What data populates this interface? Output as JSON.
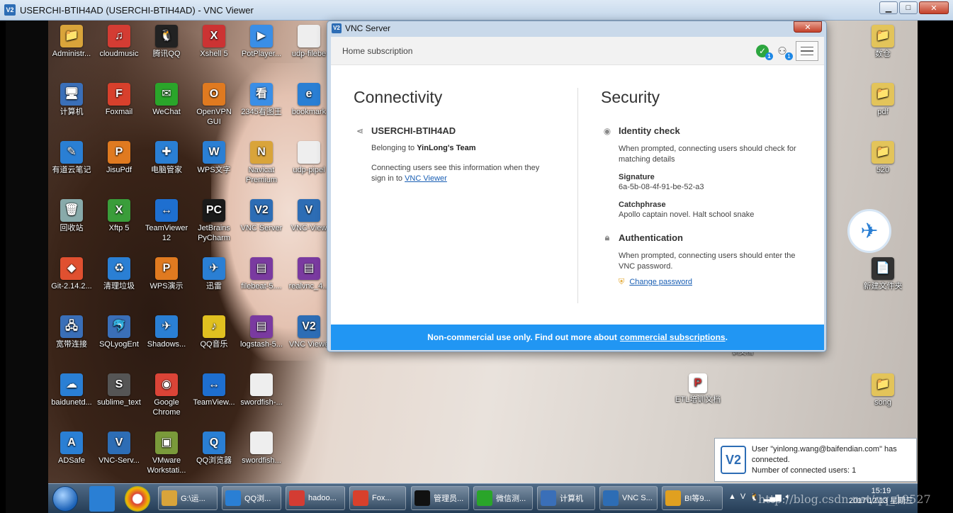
{
  "viewer": {
    "title": "USERCHI-BTIH4AD (USERCHI-BTIH4AD) - VNC Viewer",
    "minimize": "▁",
    "maximize": "□",
    "close": "✕"
  },
  "desktop_icons_left": [
    {
      "label": "Administr...",
      "color": "#d9a43a",
      "glyph": "📁"
    },
    {
      "label": "cloudmusic",
      "color": "#d43c33",
      "glyph": "♫"
    },
    {
      "label": "腾讯QQ",
      "color": "#222",
      "glyph": "🐧"
    },
    {
      "label": "Xshell 5",
      "color": "#c33",
      "glyph": "X"
    },
    {
      "label": "PotPlayer...",
      "color": "#3a8ee6",
      "glyph": "▶"
    },
    {
      "label": "udp-filebe",
      "color": "#eee",
      "glyph": ""
    },
    {
      "label": "计算机",
      "color": "#3a6fb8",
      "glyph": "🖥"
    },
    {
      "label": "Foxmail",
      "color": "#d8402c",
      "glyph": "F"
    },
    {
      "label": "WeChat",
      "color": "#2aa52a",
      "glyph": "✉"
    },
    {
      "label": "OpenVPN GUI",
      "color": "#e07a20",
      "glyph": "O"
    },
    {
      "label": "2345看图王",
      "color": "#3a8ee6",
      "glyph": "看"
    },
    {
      "label": "bookmark",
      "color": "#2a7fd4",
      "glyph": "e"
    },
    {
      "label": "有道云笔记",
      "color": "#2a7fd4",
      "glyph": "✎"
    },
    {
      "label": "JisuPdf",
      "color": "#e07a20",
      "glyph": "P"
    },
    {
      "label": "电脑管家",
      "color": "#2a7fd4",
      "glyph": "✚"
    },
    {
      "label": "WPS文字",
      "color": "#2a7fd4",
      "glyph": "W"
    },
    {
      "label": "Navicat Premium",
      "color": "#d9a43a",
      "glyph": "N"
    },
    {
      "label": "udp-pipel",
      "color": "#eee",
      "glyph": ""
    },
    {
      "label": "回收站",
      "color": "#8aa",
      "glyph": "🗑"
    },
    {
      "label": "Xftp 5",
      "color": "#3a9d3a",
      "glyph": "X"
    },
    {
      "label": "TeamViewer 12",
      "color": "#1e6fd0",
      "glyph": "↔"
    },
    {
      "label": "JetBrains PyCharm",
      "color": "#1a1a1a",
      "glyph": "PC"
    },
    {
      "label": "VNC Server",
      "color": "#2d6db5",
      "glyph": "V2"
    },
    {
      "label": "VNC-View",
      "color": "#2d6db5",
      "glyph": "V"
    },
    {
      "label": "Git-2.14.2...",
      "color": "#e05030",
      "glyph": "◆"
    },
    {
      "label": "清理垃圾",
      "color": "#2a7fd4",
      "glyph": "♻"
    },
    {
      "label": "WPS演示",
      "color": "#e07a20",
      "glyph": "P"
    },
    {
      "label": "迅雷",
      "color": "#2a7fd4",
      "glyph": "✈"
    },
    {
      "label": "filebeat-5....",
      "color": "#7a3aa0",
      "glyph": "▤"
    },
    {
      "label": "realvnc_4...",
      "color": "#7a3aa0",
      "glyph": "▤"
    },
    {
      "label": "宽带连接",
      "color": "#3a6fb8",
      "glyph": "🖧"
    },
    {
      "label": "SQLyogEnt",
      "color": "#3a6fb8",
      "glyph": "🐬"
    },
    {
      "label": "Shadows...",
      "color": "#2a7fd4",
      "glyph": "✈"
    },
    {
      "label": "QQ音乐",
      "color": "#e0c020",
      "glyph": "♪"
    },
    {
      "label": "logstash-5...",
      "color": "#7a3aa0",
      "glyph": "▤"
    },
    {
      "label": "VNC Viewe",
      "color": "#2d6db5",
      "glyph": "V2"
    },
    {
      "label": "baidunetd...",
      "color": "#2a7fd4",
      "glyph": "☁"
    },
    {
      "label": "sublime_text",
      "color": "#555",
      "glyph": "S"
    },
    {
      "label": "Google Chrome",
      "color": "#db4437",
      "glyph": "◉"
    },
    {
      "label": "TeamView...",
      "color": "#1e6fd0",
      "glyph": "↔"
    },
    {
      "label": "swordfish-...",
      "color": "#eee",
      "glyph": ""
    },
    {
      "label": "",
      "color": "",
      "glyph": ""
    },
    {
      "label": "ADSafe",
      "color": "#2a7fd4",
      "glyph": "A"
    },
    {
      "label": "VNC-Serv...",
      "color": "#2d6db5",
      "glyph": "V"
    },
    {
      "label": "VMware Workstati...",
      "color": "#7a9a3a",
      "glyph": "▣"
    },
    {
      "label": "QQ浏览器",
      "color": "#2a7fd4",
      "glyph": "Q"
    },
    {
      "label": "swordfish...",
      "color": "#eee",
      "glyph": ""
    }
  ],
  "desktop_icons_right": [
    {
      "label": "数仓",
      "color": "#e3c45a",
      "glyph": "📁"
    },
    {
      "label": "pdf",
      "color": "#e3c45a",
      "glyph": "📁"
    },
    {
      "label": "520",
      "color": "#e3c45a",
      "glyph": "📁"
    },
    {
      "label": "新建文件夹",
      "color": "#333",
      "glyph": "📄"
    },
    {
      "label": "song",
      "color": "#e3c45a",
      "glyph": "📁"
    }
  ],
  "desktop_extra": {
    "etl_label": "ETL培训文档",
    "partial_label": "训文档"
  },
  "vnc_server": {
    "window_title": "VNC Server",
    "close": "✕",
    "header_label": "Home subscription",
    "check_badge": "1",
    "user_badge": "1",
    "connectivity": {
      "heading": "Connectivity",
      "computer_name": "USERCHI-BTIH4AD",
      "belonging_prefix": "Belonging to",
      "team": "YinLong's Team",
      "info_text": "Connecting users see this information when they sign in to",
      "viewer_link": "VNC Viewer"
    },
    "security": {
      "heading": "Security",
      "identity_title": "Identity check",
      "identity_text": "When prompted, connecting users should check for matching details",
      "signature_label": "Signature",
      "signature_value": "6a-5b-08-4f-91-be-52-a3",
      "catchphrase_label": "Catchphrase",
      "catchphrase_value": "Apollo captain novel. Halt school snake",
      "auth_title": "Authentication",
      "auth_text": "When prompted, connecting users should enter the VNC password.",
      "change_password": "Change password"
    },
    "footer_text": "Non-commercial use only. Find out more about",
    "footer_link": "commercial subscriptions",
    "footer_end": "."
  },
  "notification": {
    "line1": "User \"yinlong.wang@baifendian.com\" has connected.",
    "line2": "Number of connected users: 1"
  },
  "taskbar": {
    "buttons": [
      {
        "label": "G:\\运...",
        "color": "#d9a43a"
      },
      {
        "label": "QQ浏...",
        "color": "#2a7fd4"
      },
      {
        "label": "hadoo...",
        "color": "#d43c33"
      },
      {
        "label": "Fox...",
        "color": "#d8402c"
      },
      {
        "label": "管理员...",
        "color": "#111"
      },
      {
        "label": "微信测...",
        "color": "#2aa52a"
      },
      {
        "label": "计算机",
        "color": "#3a6fb8"
      },
      {
        "label": "VNC S...",
        "color": "#2d6db5"
      },
      {
        "label": "BI等9...",
        "color": "#e0a020"
      }
    ],
    "time": "15:19",
    "date": "2017\\12\\13 星期三"
  },
  "watermark": "http://blog.csdn.net/qq_19527"
}
